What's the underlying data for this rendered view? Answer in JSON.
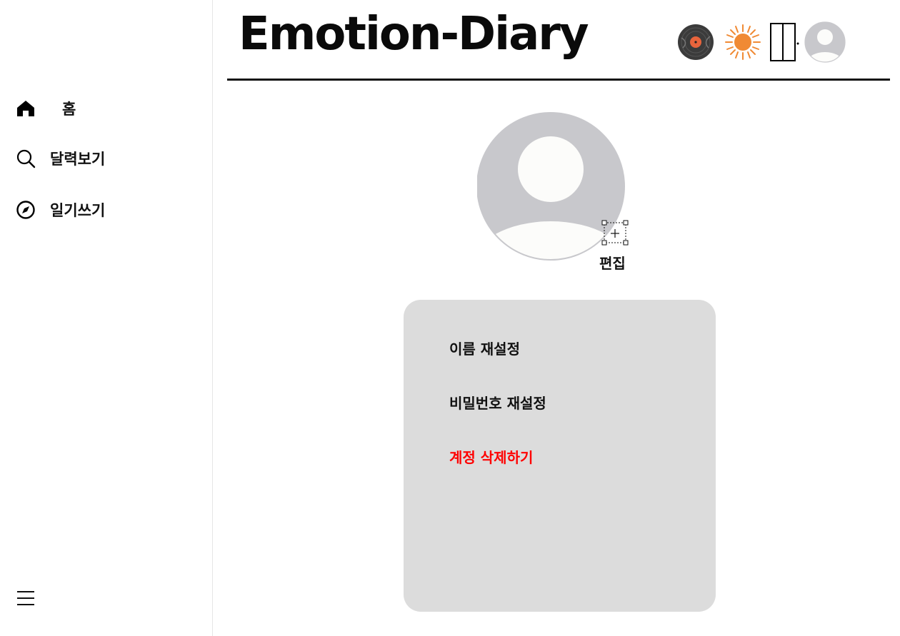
{
  "header": {
    "title": "Emotion-Diary",
    "icons": [
      "vinyl-record-icon",
      "sun-icon",
      "door-icon",
      "user-avatar-icon"
    ]
  },
  "sidebar": {
    "items": [
      {
        "label": "홈",
        "icon": "home-icon"
      },
      {
        "label": "달력보기",
        "icon": "search-icon"
      },
      {
        "label": "일기쓰기",
        "icon": "compass-icon"
      }
    ],
    "menu_icon": "hamburger-menu-icon"
  },
  "profile": {
    "edit_label": "편집"
  },
  "settings": {
    "items": [
      {
        "label": "이름 재설정"
      },
      {
        "label": "비밀번호 재설정"
      },
      {
        "label": "계정 삭제하기",
        "color": "#ff0000"
      }
    ]
  },
  "colors": {
    "danger": "#ff0000",
    "card_bg": "#dcdcdc",
    "avatar_bg": "#c8c8cc",
    "sun": "#f08a34"
  }
}
